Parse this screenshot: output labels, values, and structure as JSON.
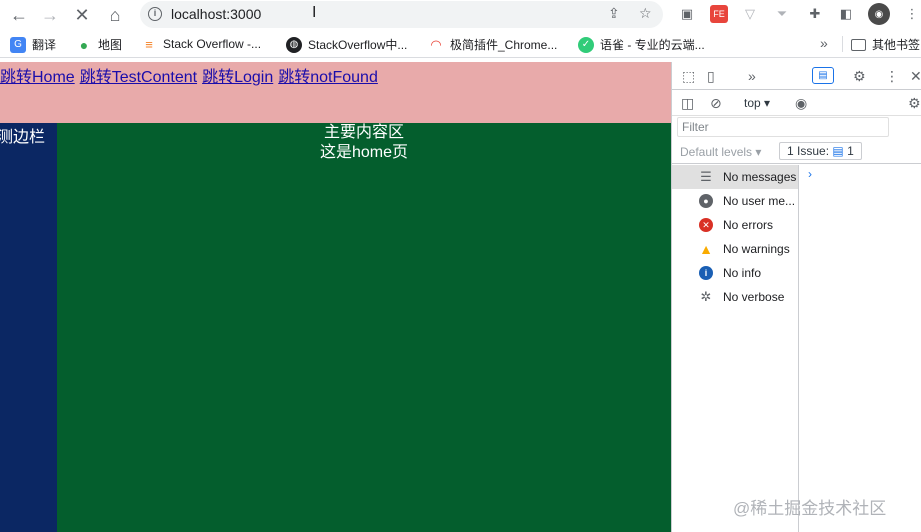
{
  "browser": {
    "url": "localhost:3000",
    "url_cursor": "I",
    "bookmarks": [
      {
        "label": "翻译",
        "icon": "translate-icon",
        "color": "#4285f4"
      },
      {
        "label": "地图",
        "icon": "maps-pin-icon",
        "color": "#34a853"
      },
      {
        "label": "Stack Overflow -...",
        "icon": "stackoverflow-icon",
        "color": "#f48024"
      },
      {
        "label": "StackOverflow中...",
        "icon": "globe-icon",
        "color": "#202124"
      },
      {
        "label": "极简插件_Chrome...",
        "icon": "rainbow-icon",
        "color": "#e94235"
      },
      {
        "label": "语雀 - 专业的云端...",
        "icon": "yuque-icon",
        "color": "#31cc79"
      }
    ],
    "bookmarks_more": "»",
    "other_bookmarks": "其他书签"
  },
  "page": {
    "nav_links": [
      "跳转Home",
      "跳转TestContent",
      "跳转Login",
      "跳转notFound"
    ],
    "sidebar_text": "测边栏",
    "main_title": "主要内容区",
    "main_subtitle": "这是home页",
    "colors": {
      "header": "#e8aaaa",
      "sidebar": "#0b2763",
      "main": "#045e2d",
      "link": "#1a0dab"
    }
  },
  "devtools": {
    "context": "top",
    "filter_placeholder": "Filter",
    "default_levels": "Default levels",
    "issues_label": "1 Issue:",
    "issues_count": "1",
    "sidebar_items": [
      {
        "label": "No messages",
        "icon": "list-icon",
        "color": "#5f6368"
      },
      {
        "label": "No user me...",
        "icon": "user-icon",
        "color": "#5f6368"
      },
      {
        "label": "No errors",
        "icon": "error-icon",
        "color": "#d93025"
      },
      {
        "label": "No warnings",
        "icon": "warning-icon",
        "color": "#f9ab00"
      },
      {
        "label": "No info",
        "icon": "info-icon",
        "color": "#1a5fb4"
      },
      {
        "label": "No verbose",
        "icon": "bug-icon",
        "color": "#5f6368"
      }
    ]
  },
  "watermark": "@稀土掘金技术社区"
}
